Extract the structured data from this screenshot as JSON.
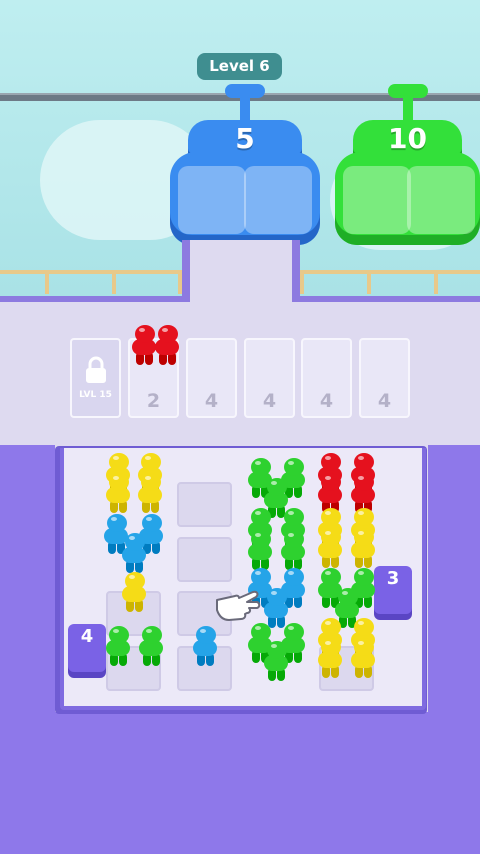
{
  "hud": {
    "level_label": "Level 6"
  },
  "gondolas": [
    {
      "capacity": "5",
      "color": "#3a8cf0",
      "dark": "#2466c8"
    },
    {
      "capacity": "10",
      "color": "#33e03a",
      "dark": "#1fae26"
    }
  ],
  "queue": {
    "locked_slot": {
      "label": "LVL 15",
      "icon": "lock-icon"
    },
    "slots": [
      {
        "number": "2",
        "occupant_color": "red"
      },
      {
        "number": "4"
      },
      {
        "number": "4"
      },
      {
        "number": "4"
      },
      {
        "number": "4"
      }
    ]
  },
  "board": {
    "badges": [
      {
        "id": "badge-right",
        "value": "3"
      },
      {
        "id": "badge-left",
        "value": "4"
      }
    ]
  },
  "colors": {
    "yellow": "#f5dc17",
    "blue": "#25a4e8",
    "green": "#2ed12f",
    "red": "#e5111e",
    "accent_purple": "#8e78ea"
  },
  "cursor": {
    "icon": "pointing-hand-icon"
  }
}
